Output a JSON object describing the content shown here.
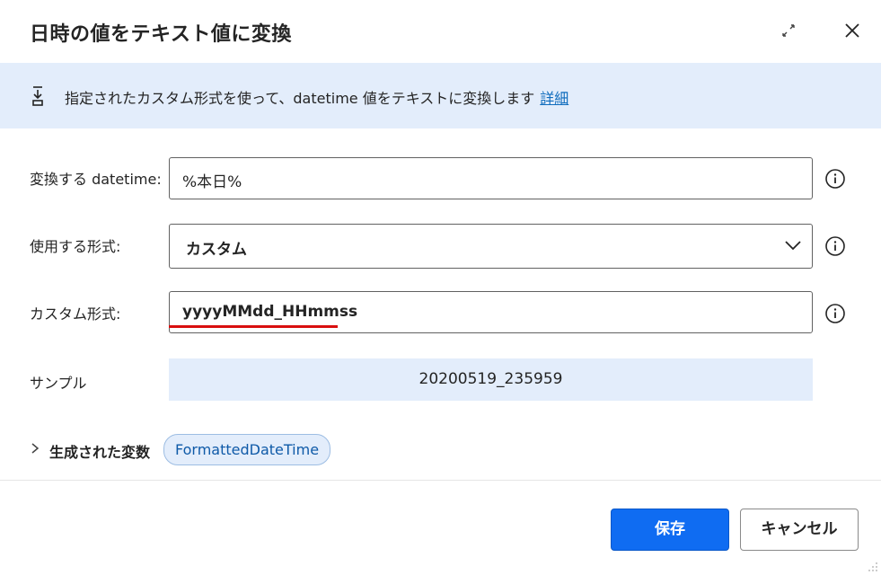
{
  "dialog": {
    "title": "日時の値をテキスト値に変換"
  },
  "banner": {
    "text": "指定されたカスタム形式を使って、datetime 値をテキストに変換します",
    "link": "詳細"
  },
  "form": {
    "datetime_label": "変換する datetime:",
    "datetime_value": "%本日%",
    "format_label": "使用する形式:",
    "format_value": "カスタム",
    "custom_label": "カスタム形式:",
    "custom_value": "yyyyMMdd_HHmmss",
    "sample_label": "サンプル",
    "sample_value": "20200519_235959"
  },
  "generated": {
    "label": "生成された変数",
    "variable": "FormattedDateTime"
  },
  "buttons": {
    "save": "保存",
    "cancel": "キャンセル"
  },
  "icons": {
    "expand": "expand-icon",
    "close": "close-icon",
    "banner": "convert-icon",
    "info": "info-icon",
    "chevron_down": "chevron-down-icon",
    "chevron_right": "chevron-right-icon"
  },
  "colors": {
    "accent": "#0f6cf2",
    "banner_bg": "#e3edfb",
    "link": "#0f6cbd",
    "highlight_underline": "#d90f0f"
  }
}
